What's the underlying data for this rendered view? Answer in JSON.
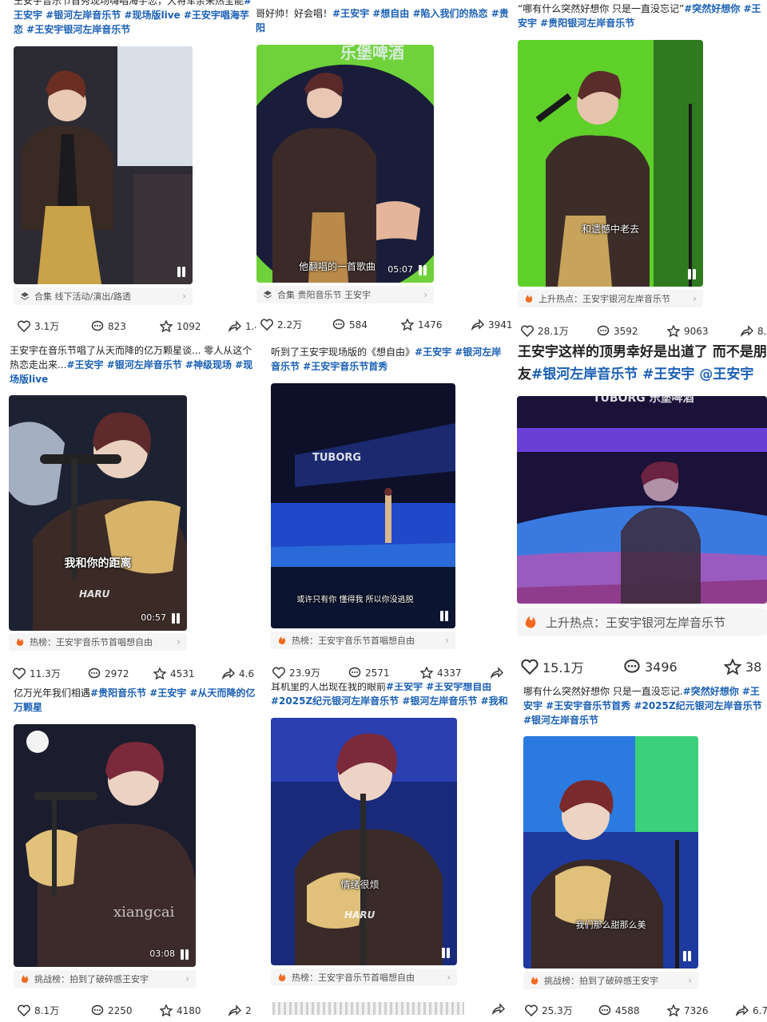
{
  "cards": [
    {
      "caption": "王安宇音乐节首秀现场嗨唱海芋恋，大将军亲来热全能",
      "caption_tags": "#王安宇 #银河左岸音乐节 #现场版live #王安宇唱海芋恋 #王安宇银河左岸音乐节",
      "subtitle": "",
      "duration": "",
      "ref_icon": "collection-icon",
      "ref_text": "合集  线下活动/演出/路透",
      "likes": "3.1万",
      "comments": "823",
      "favorites": "1092",
      "shares": "1.4"
    },
    {
      "caption": "哥好帅！好会唱！",
      "caption_tags": "#王安宇 #想自由 #陷入我们的热恋 #贵阳",
      "subtitle": "他翻唱的一首歌曲",
      "duration": "05:07",
      "ref_icon": "collection-icon",
      "ref_text": "合集  贵阳音乐节 王安宇",
      "likes": "2.2万",
      "comments": "584",
      "favorites": "1476",
      "shares": "3941"
    },
    {
      "caption": "“哪有什么突然好想你 只是一直没忘记”",
      "caption_tags": "#突然好想你 #王安宇 #贵阳银河左岸音乐节",
      "subtitle": "和遗憾中老去",
      "duration": "",
      "ref_icon": "flame-icon",
      "ref_text": "上升热点：王安宇银河左岸音乐节",
      "likes": "28.1万",
      "comments": "3592",
      "favorites": "9063",
      "shares": "8."
    },
    {
      "caption": "王安宇在音乐节唱了从天而降的亿万颗星谈... 零人从这个热恋走出来...",
      "caption_tags": "#王安宇 #银河左岸音乐节 #神级现场 #现场版live",
      "subtitle": "我和你的距离",
      "duration": "00:57",
      "ref_icon": "flame-icon",
      "ref_text": "热榜：王安宇音乐节首唱想自由",
      "likes": "11.3万",
      "comments": "2972",
      "favorites": "4531",
      "shares": "4.6"
    },
    {
      "caption": "听到了王安宇现场版的《想自由》",
      "caption_tags": "#王安宇 #银河左岸音乐节 #王安宇音乐节首秀",
      "subtitle": "或许只有你 懂得我 所以你没逃脱",
      "duration": "",
      "ref_icon": "flame-icon",
      "ref_text": "热榜：王安宇音乐节首唱想自由",
      "likes": "23.9万",
      "comments": "2571",
      "favorites": "4337",
      "shares": ""
    },
    {
      "caption": "王安宇这样的顶男幸好是出道了 而不是朋友",
      "caption_tags": "#银河左岸音乐节 #王安宇 @王安宇",
      "subtitle": "",
      "duration": "",
      "ref_icon": "flame-icon",
      "ref_text": "上升热点：王安宇银河左岸音乐节",
      "likes": "15.1万",
      "comments": "3496",
      "favorites": "38",
      "shares": ""
    },
    {
      "caption": "亿万光年我们相遇",
      "caption_tags": "#贵阳音乐节 #王安宇 #从天而降的亿万颗星",
      "subtitle": "",
      "duration": "03:08",
      "watermark": "xiangcai",
      "ref_icon": "flame-icon",
      "ref_text": "挑战榜：拍到了破碎感王安宇",
      "likes": "8.1万",
      "comments": "2250",
      "favorites": "4180",
      "shares": "2"
    },
    {
      "caption": "耳机里的人出现在我的眼前",
      "caption_tags": "#王安宇 #王安宇想自由 #2025Z纪元银河左岸音乐节 #银河左岸音乐节 #我和",
      "subtitle": "情绪很烦",
      "duration": "",
      "ref_icon": "flame-icon",
      "ref_text": "热榜：王安宇音乐节首唱想自由",
      "likes": "",
      "comments": "",
      "favorites": "",
      "shares": ""
    },
    {
      "caption": "哪有什么突然好想你 只是一直没忘记.",
      "caption_tags": "#突然好想你 #王安宇 #王安宇音乐节首秀 #2025Z纪元银河左岸音乐节 #银河左岸音乐节",
      "subtitle": "我们那么甜那么美",
      "duration": "",
      "ref_icon": "flame-icon",
      "ref_text": "挑战榜：拍到了破碎感王安宇",
      "likes": "25.3万",
      "comments": "4588",
      "favorites": "7326",
      "shares": "6.7"
    }
  ],
  "overlay_brands": {
    "card2_banner": "乐堡啤酒",
    "card5_banner": "TUBORG",
    "card6_banner": "TUBORG 乐堡啤酒",
    "hand_logo": "HARU"
  },
  "colors": {
    "tag_blue": "#1a5fb4",
    "flame": "#f26b21",
    "green_screen": "#5fcf2a",
    "stage_blue": "#1a3fb8"
  }
}
